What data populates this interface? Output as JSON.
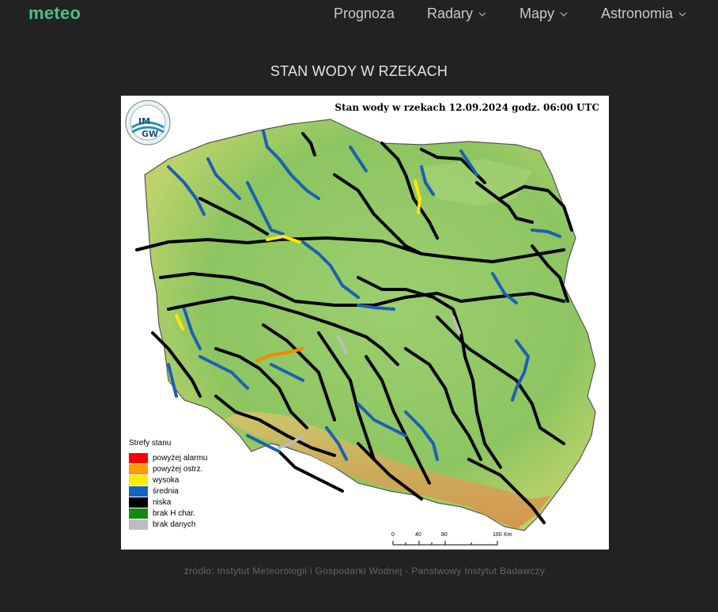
{
  "header": {
    "logo": "meteo",
    "nav": [
      {
        "label": "Prognoza",
        "has_dropdown": false
      },
      {
        "label": "Radary",
        "has_dropdown": true
      },
      {
        "label": "Mapy",
        "has_dropdown": true
      },
      {
        "label": "Astronomia",
        "has_dropdown": true
      }
    ]
  },
  "page": {
    "title": "STAN WODY W RZEKACH",
    "source": "źródło: Instytut Meteorologii i Gospodarki Wodnej - Państwowy Instytut Badawczy"
  },
  "map": {
    "heading": "Stan wody w rzekach 12.09.2024 godz. 06:00 UTC",
    "logo_text": [
      "IM",
      "GW"
    ],
    "legend": {
      "title": "Strefy stanu",
      "items": [
        {
          "label": "powyżej alarmu",
          "color": "#ff0000"
        },
        {
          "label": "powyżej ostrz.",
          "color": "#ff9900"
        },
        {
          "label": "wysoka",
          "color": "#ffee00"
        },
        {
          "label": "średnia",
          "color": "#1565c0"
        },
        {
          "label": "niska",
          "color": "#000000"
        },
        {
          "label": "brak H char.",
          "color": "#138a13"
        },
        {
          "label": "brak danych",
          "color": "#bdbdbd"
        }
      ]
    },
    "scale": {
      "ticks": [
        "0",
        "40",
        "80",
        "160"
      ],
      "unit": "Km"
    }
  },
  "colors": {
    "background": "#222222",
    "accent": "#4dbf86",
    "nav_text": "#c9c9c9",
    "terrain_low": "#8fc96a",
    "terrain_high": "#e0a85c"
  }
}
